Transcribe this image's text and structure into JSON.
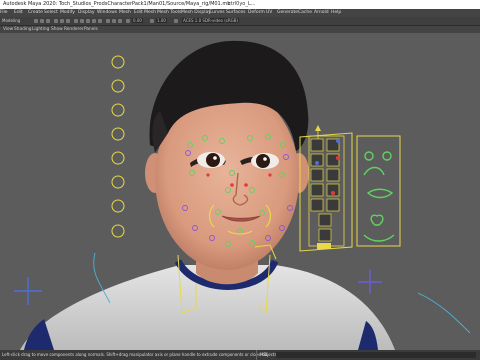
{
  "window": {
    "title": "Autodesk Maya 2020: Toch_Studios_ProdsCharacterPack1/Man01/Source/Maya_rig/M01.mb",
    "tab": "ctrl0yo_L..."
  },
  "menubar": [
    "File",
    "Edit",
    "Create",
    "Select",
    "Modify",
    "Display",
    "Windows",
    "Mesh",
    "Edit Mesh",
    "Mesh Tools",
    "Mesh Display",
    "Curves",
    "Surfaces",
    "Deform",
    "UV",
    "Generate",
    "Cache",
    "Arnold",
    "Help"
  ],
  "toolbar": {
    "workspace": "Modeling",
    "field1": "0.00",
    "field2": "1.00",
    "renderer": "ACES 1.0 SDR-video (sRGB)"
  },
  "panel_menu": [
    "View",
    "Shading",
    "Lighting",
    "Show",
    "Renderer",
    "Panels"
  ],
  "statusbar": {
    "message": "Left-click drag to move components along normals. Shift+drag manipulator axis or plane handle to extrude components or clone objects. Ctrl+Shift+drag to over",
    "mel_label": "MEL"
  },
  "colors": {
    "rig_yellow": "#e8d84a",
    "rig_green": "#5fd35f",
    "rig_red": "#e23a3a",
    "rig_blue": "#4f6ed8",
    "rig_purple": "#8a55d8"
  }
}
